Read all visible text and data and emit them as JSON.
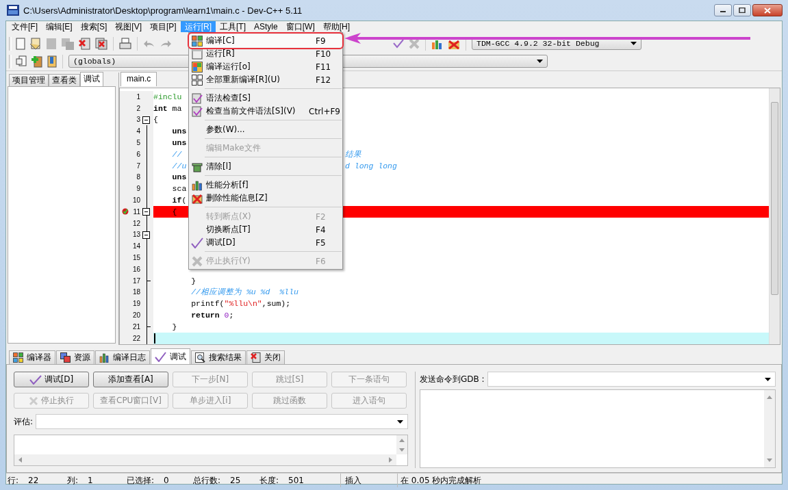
{
  "window": {
    "title": "C:\\Users\\Administrator\\Desktop\\program\\learn1\\main.c - Dev-C++ 5.11"
  },
  "menubar": [
    {
      "label": "文件[F]",
      "selected": false
    },
    {
      "label": "编辑[E]",
      "selected": false
    },
    {
      "label": "搜索[S]",
      "selected": false
    },
    {
      "label": "视图[V]",
      "selected": false
    },
    {
      "label": "项目[P]",
      "selected": false
    },
    {
      "label": "运行[R]",
      "selected": true
    },
    {
      "label": "工具[T]",
      "selected": false
    },
    {
      "label": "AStyle",
      "selected": false
    },
    {
      "label": "窗口[W]",
      "selected": false
    },
    {
      "label": "帮助[H]",
      "selected": false
    }
  ],
  "toolbar": {
    "compiler_select": "TDM-GCC 4.9.2 32-bit Debug",
    "scope_select": "(globals)"
  },
  "run_menu": [
    {
      "kind": "item",
      "label": "编译[C]",
      "shortcut": "F9",
      "disabled": false,
      "selected": true
    },
    {
      "kind": "item",
      "label": "运行[R]",
      "shortcut": "F10",
      "disabled": false,
      "selected": false
    },
    {
      "kind": "item",
      "label": "编译运行[o]",
      "shortcut": "F11",
      "disabled": false,
      "selected": false
    },
    {
      "kind": "item",
      "label": "全部重新编译[R](U)",
      "shortcut": "F12",
      "disabled": false,
      "selected": false
    },
    {
      "kind": "separator"
    },
    {
      "kind": "item",
      "label": "语法检查[S]",
      "disabled": false,
      "selected": false
    },
    {
      "kind": "item",
      "label": "检查当前文件语法[S](V)",
      "shortcut": "Ctrl+F9",
      "disabled": false,
      "selected": false
    },
    {
      "kind": "separator"
    },
    {
      "kind": "item",
      "label": "参数(W)...",
      "disabled": false,
      "selected": false
    },
    {
      "kind": "separator"
    },
    {
      "kind": "item",
      "label": "编辑Make文件",
      "disabled": true,
      "selected": false
    },
    {
      "kind": "separator"
    },
    {
      "kind": "item",
      "label": "清除[l]",
      "disabled": false,
      "selected": false
    },
    {
      "kind": "separator"
    },
    {
      "kind": "item",
      "label": "性能分析[f]",
      "disabled": false,
      "selected": false
    },
    {
      "kind": "item",
      "label": "删除性能信息[Z]",
      "disabled": false,
      "selected": false
    },
    {
      "kind": "separator"
    },
    {
      "kind": "item",
      "label": "转到断点(X)",
      "shortcut": "F2",
      "disabled": true,
      "selected": false
    },
    {
      "kind": "item",
      "label": "切换断点[T]",
      "shortcut": "F4",
      "disabled": false,
      "selected": false
    },
    {
      "kind": "item",
      "label": "调试[D]",
      "shortcut": "F5",
      "disabled": false,
      "selected": false
    },
    {
      "kind": "separator"
    },
    {
      "kind": "item",
      "label": "停止执行(Y)",
      "shortcut": "F6",
      "disabled": true,
      "selected": false
    }
  ],
  "left_panel": {
    "tabs": [
      {
        "label": "项目管理",
        "selected": false
      },
      {
        "label": "查看类",
        "selected": false
      },
      {
        "label": "调试",
        "selected": true
      }
    ]
  },
  "editor": {
    "tabs": [
      {
        "label": "main.c",
        "selected": true
      }
    ],
    "lines": [
      {
        "number": "1",
        "segments": [
          {
            "text": "#inclu",
            "kind": "preproc"
          }
        ]
      },
      {
        "number": "2",
        "segments": [
          {
            "text": "int",
            "kind": "keyword"
          },
          {
            "text": " ma",
            "kind": "code"
          }
        ]
      },
      {
        "number": "3",
        "expanded": true,
        "segments": [
          {
            "text": "{",
            "kind": "code"
          }
        ]
      },
      {
        "number": "4",
        "segments": [
          {
            "text": "    uns",
            "kind": "keyword"
          }
        ]
      },
      {
        "number": "5",
        "segments": [
          {
            "text": "    uns",
            "kind": "keyword"
          }
        ]
      },
      {
        "number": "6",
        "segments": [
          {
            "text": "    //",
            "kind": "comment"
          }
        ],
        "tail": [
          {
            "text": "结果",
            "kind": "comment"
          }
        ]
      },
      {
        "number": "7",
        "segments": [
          {
            "text": "    //u",
            "kind": "comment"
          }
        ],
        "tail": [
          {
            "text": "d long long",
            "kind": "comment"
          }
        ]
      },
      {
        "number": "8",
        "segments": [
          {
            "text": "    uns",
            "kind": "keyword"
          }
        ]
      },
      {
        "number": "9",
        "segments": [
          {
            "text": "    sca",
            "kind": "code"
          }
        ]
      },
      {
        "number": "10",
        "segments": [
          {
            "text": "    if",
            "kind": "keyword"
          },
          {
            "text": "(",
            "kind": "code"
          }
        ]
      },
      {
        "number": "11",
        "expanded": true,
        "breakpoint": true,
        "segments": [
          {
            "text": "    {",
            "kind": "code"
          }
        ]
      },
      {
        "number": "12"
      },
      {
        "number": "13",
        "expanded": true
      },
      {
        "number": "14"
      },
      {
        "number": "15"
      },
      {
        "number": "16"
      },
      {
        "number": "17",
        "fold_end": true,
        "segments": [
          {
            "text": "        }",
            "kind": "code"
          }
        ]
      },
      {
        "number": "18",
        "segments": [
          {
            "text": "        //相应调整为 %u %d  %llu",
            "kind": "comment"
          }
        ]
      },
      {
        "number": "19",
        "segments": [
          {
            "text": "        printf(",
            "kind": "code"
          },
          {
            "text": "\"%llu\\n\"",
            "kind": "string"
          },
          {
            "text": ",sum);",
            "kind": "code"
          }
        ]
      },
      {
        "number": "20",
        "segments": [
          {
            "text": "        return",
            "kind": "keyword"
          },
          {
            "text": " 0",
            "kind": "number"
          },
          {
            "text": ";",
            "kind": "code"
          }
        ]
      },
      {
        "number": "21",
        "fold_end": true,
        "segments": [
          {
            "text": "    }",
            "kind": "code"
          }
        ]
      },
      {
        "number": "22",
        "current": true
      }
    ]
  },
  "bottom_tabs": [
    {
      "label": "编译器",
      "selected": false
    },
    {
      "label": "资源",
      "selected": false
    },
    {
      "label": "编译日志",
      "selected": false
    },
    {
      "label": "调试",
      "selected": true
    },
    {
      "label": "搜索结果",
      "selected": false
    },
    {
      "label": "关闭",
      "selected": false
    }
  ],
  "debug_panel": {
    "buttons": [
      {
        "label": "调试[D]",
        "disabled": false
      },
      {
        "label": "添加查看[A]",
        "disabled": false
      },
      {
        "label": "下一步[N]",
        "disabled": true
      },
      {
        "label": "跳过[S]",
        "disabled": true
      },
      {
        "label": "下一条语句",
        "disabled": true
      },
      {
        "label": "停止执行",
        "disabled": true
      },
      {
        "label": "查看CPU窗口[V]",
        "disabled": true
      },
      {
        "label": "单步进入[i]",
        "disabled": true
      },
      {
        "label": "跳过函数",
        "disabled": true
      },
      {
        "label": "进入语句",
        "disabled": true
      }
    ],
    "evaluate_label": "评估:",
    "gdb_label": "发送命令到GDB :"
  },
  "status_bar": [
    {
      "label": "行:",
      "value": "22"
    },
    {
      "label": "列:",
      "value": "1"
    },
    {
      "label": "已选择:",
      "value": "0"
    },
    {
      "label": "总行数:",
      "value": "25"
    },
    {
      "label": "长度:",
      "value": "501"
    },
    {
      "value": "插入"
    },
    {
      "value": "在 0.05 秒内完成解析"
    }
  ]
}
